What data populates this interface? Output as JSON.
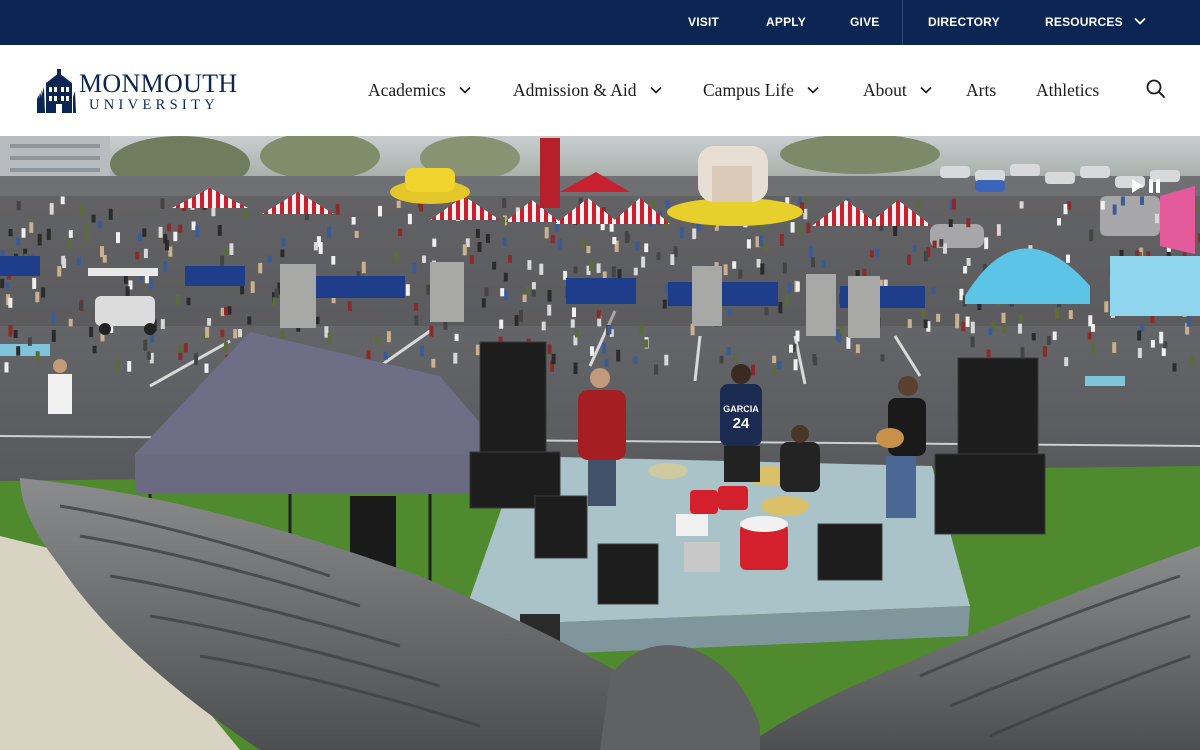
{
  "utility_nav": {
    "items": [
      {
        "label": "VISIT"
      },
      {
        "label": "APPLY"
      },
      {
        "label": "GIVE"
      },
      {
        "label": "DIRECTORY"
      },
      {
        "label": "RESOURCES"
      }
    ]
  },
  "logo": {
    "wordmark": "MONMOUTH",
    "subtitle": "UNIVERSITY"
  },
  "main_nav": {
    "items": [
      {
        "label": "Academics"
      },
      {
        "label": "Admission & Aid"
      },
      {
        "label": "Campus Life"
      },
      {
        "label": "About"
      },
      {
        "label": "Arts"
      },
      {
        "label": "Athletics"
      }
    ]
  },
  "hero": {
    "jersey_name": "GARCIA",
    "jersey_number": "24"
  },
  "colors": {
    "navy": "#0b2653",
    "tent_red": "#c8202f",
    "grass": "#4f8a2f"
  },
  "icons": [
    "chevron-down-icon",
    "search-icon",
    "play-icon",
    "pause-icon"
  ]
}
